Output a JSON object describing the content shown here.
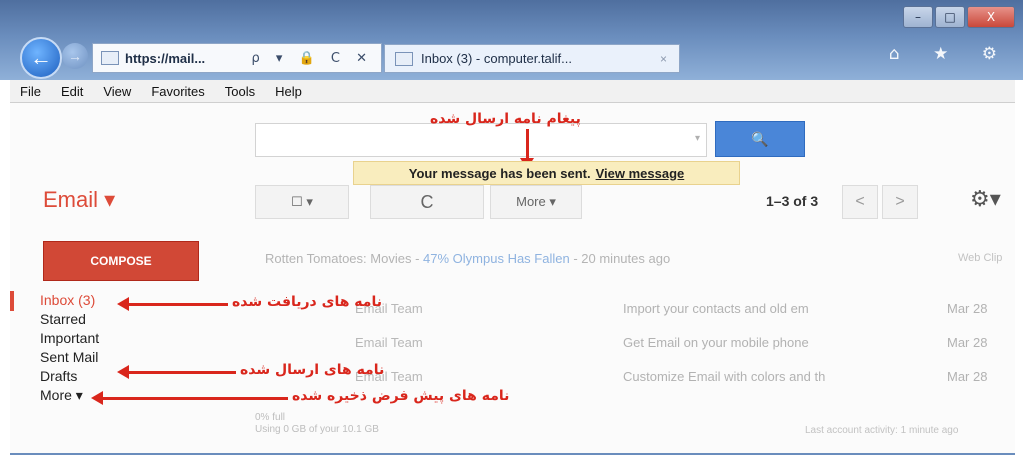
{
  "browser": {
    "address_url": "https://mail...",
    "address_controls": "ρ ▾ 🔒 C ✕",
    "tab_title": "Inbox (3) - computer.talif...",
    "tab_close": "×",
    "right_icons": "⌂ ★ ⚙",
    "win_min": "–",
    "win_max": "□",
    "win_close": "X"
  },
  "menu": [
    "File",
    "Edit",
    "View",
    "Favorites",
    "Tools",
    "Help"
  ],
  "search": {
    "button_icon": "🔍",
    "dropdown_glyph": "▾"
  },
  "notice": {
    "text": "Your message has been sent.",
    "link": "View message"
  },
  "annotations": {
    "sent_message": "پیغام نامه ارسال شده",
    "received": "نامه های دریافت شده",
    "sent_mail": "نامه های ارسال شده",
    "drafts": "نامه های پیش فرض ذخیره شده"
  },
  "app": {
    "brand": "Email ▾"
  },
  "toolbar": {
    "select_label": "☐ ▾",
    "refresh_icon": "C",
    "more_label": "More ▾",
    "paging": "1–3 of 3",
    "prev": "<",
    "next": ">",
    "settings_icon": "⚙▾"
  },
  "compose_label": "COMPOSE",
  "promo": {
    "source": "Rotten Tomatoes: Movies",
    "highlight": "47% Olympus Has Fallen",
    "time": "20 minutes ago",
    "right": "Web Clip"
  },
  "nav": [
    "Inbox (3)",
    "Starred",
    "Important",
    "Sent Mail",
    "Drafts",
    "More ▾"
  ],
  "messages": [
    {
      "sender": "Email Team",
      "subject": "Import your contacts and old em",
      "date": "Mar 28"
    },
    {
      "sender": "Email Team",
      "subject": "Get Email on your mobile phone",
      "date": "Mar 28"
    },
    {
      "sender": "Email Team",
      "subject": "Customize Email with colors and th",
      "date": "Mar 28"
    }
  ],
  "storage": {
    "percent": "0% full",
    "usage": "Using 0 GB of your 10.1 GB"
  },
  "activity": "Last account activity: 1 minute ago",
  "colors": {
    "accent": "#dd4b39",
    "annotation": "#d9261c",
    "notice_bg": "#f9edbe",
    "search_button": "#4a86d8"
  }
}
